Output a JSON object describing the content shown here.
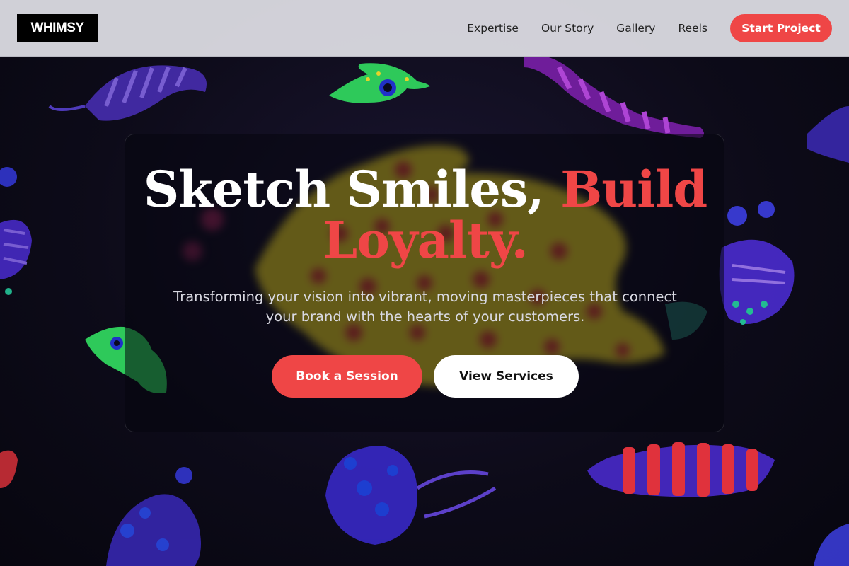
{
  "brand": {
    "logo": "WHIMSY"
  },
  "nav": {
    "items": [
      {
        "label": "Expertise"
      },
      {
        "label": "Our Story"
      },
      {
        "label": "Gallery"
      },
      {
        "label": "Reels"
      }
    ],
    "cta": "Start Project"
  },
  "hero": {
    "title_main": "Sketch Smiles,",
    "title_accent": "Build Loyalty.",
    "subtitle": "Transforming your vision into vibrant, moving masterpieces that connect your brand with the hearts of your customers.",
    "primary_button": "Book a Session",
    "secondary_button": "View Services"
  },
  "colors": {
    "accent": "#ef4646",
    "header_bg": "#e0e0e6",
    "page_bg": "#0c0a16"
  }
}
